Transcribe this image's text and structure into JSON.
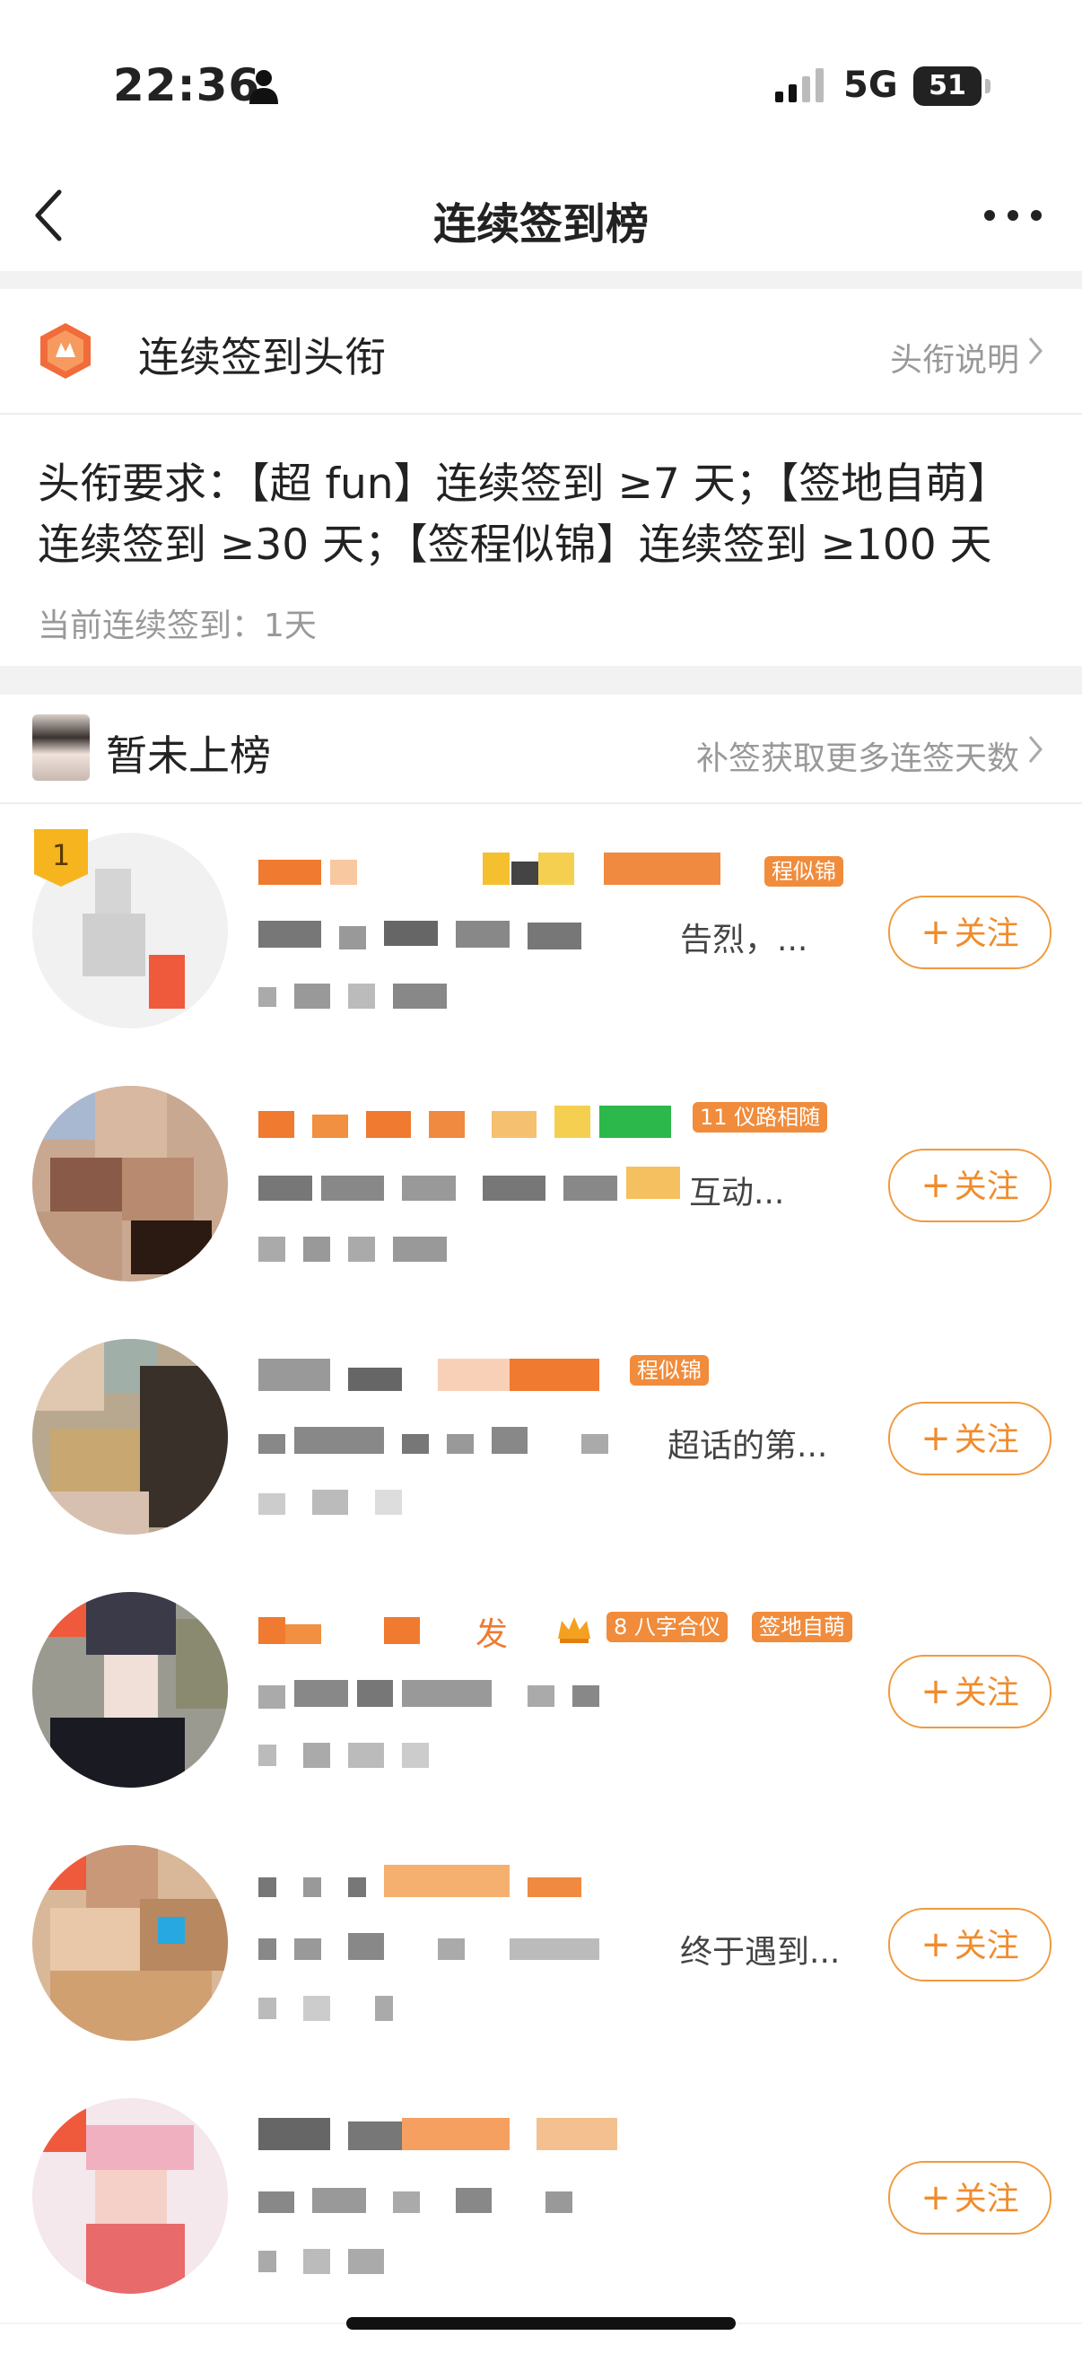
{
  "status_bar": {
    "time": "22:36",
    "network": "5G",
    "battery": "51"
  },
  "nav": {
    "title": "连续签到榜"
  },
  "title_section": {
    "label": "连续签到头衔",
    "explain": "头衔说明",
    "requirement_line1": "头衔要求：【超 fun】连续签到 ≥7 天；【签地自萌】",
    "requirement_line2": "连续签到 ≥30 天；【签程似锦】连续签到 ≥100 天",
    "current": "当前连续签到：1天"
  },
  "rank_header": {
    "status": "暂未上榜",
    "supplement": "补签获取更多连签天数"
  },
  "list": {
    "follow_label": "关注",
    "items": [
      {
        "rank": "1",
        "desc_tail": "告烈，...",
        "tags": [
          "程似锦"
        ]
      },
      {
        "desc_tail": "互动...",
        "tags": [
          "11",
          "仪路相随"
        ]
      },
      {
        "desc_tail": "超话的第...",
        "tags": [
          "程似锦"
        ]
      },
      {
        "name_tail": "发",
        "desc_tail": "",
        "tags": [
          "8",
          "八字合仪",
          "签地自萌"
        ]
      },
      {
        "desc_tail": "终于遇到...",
        "tags": []
      },
      {
        "desc_tail": "",
        "tags": []
      }
    ]
  },
  "colors": {
    "accent": "#f08c2c",
    "tag_orange": "#f08c3c",
    "tag_green": "#2db84c"
  }
}
